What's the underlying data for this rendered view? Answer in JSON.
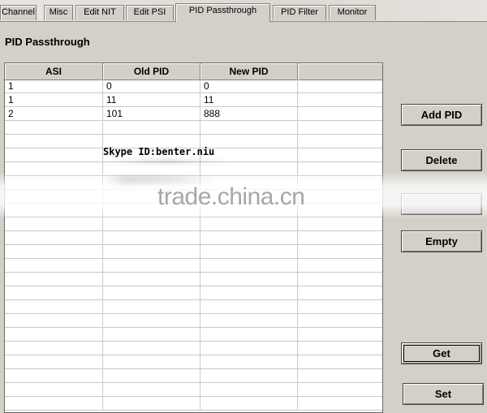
{
  "tabs": [
    {
      "label": "Channel"
    },
    {
      "label": "Misc"
    },
    {
      "label": "Edit NIT"
    },
    {
      "label": "Edit PSI"
    },
    {
      "label": "PID Passthrough"
    },
    {
      "label": "PID Filter"
    },
    {
      "label": "Monitor"
    }
  ],
  "active_tab": "PID Passthrough",
  "page_title": "PID Passthrough",
  "table": {
    "columns": [
      "ASI",
      "Old PID",
      "New PID",
      ""
    ],
    "rows": [
      [
        "1",
        "0",
        "0",
        ""
      ],
      [
        "1",
        "11",
        "11",
        ""
      ],
      [
        "2",
        "101",
        "888",
        ""
      ]
    ]
  },
  "buttons": {
    "add_pid": "Add PID",
    "delete": "Delete",
    "empty": "Empty",
    "get": "Get",
    "set": "Set"
  },
  "overlay": {
    "skype_text": "Skype ID:benter.niu",
    "watermark": "trade.china.cn"
  }
}
